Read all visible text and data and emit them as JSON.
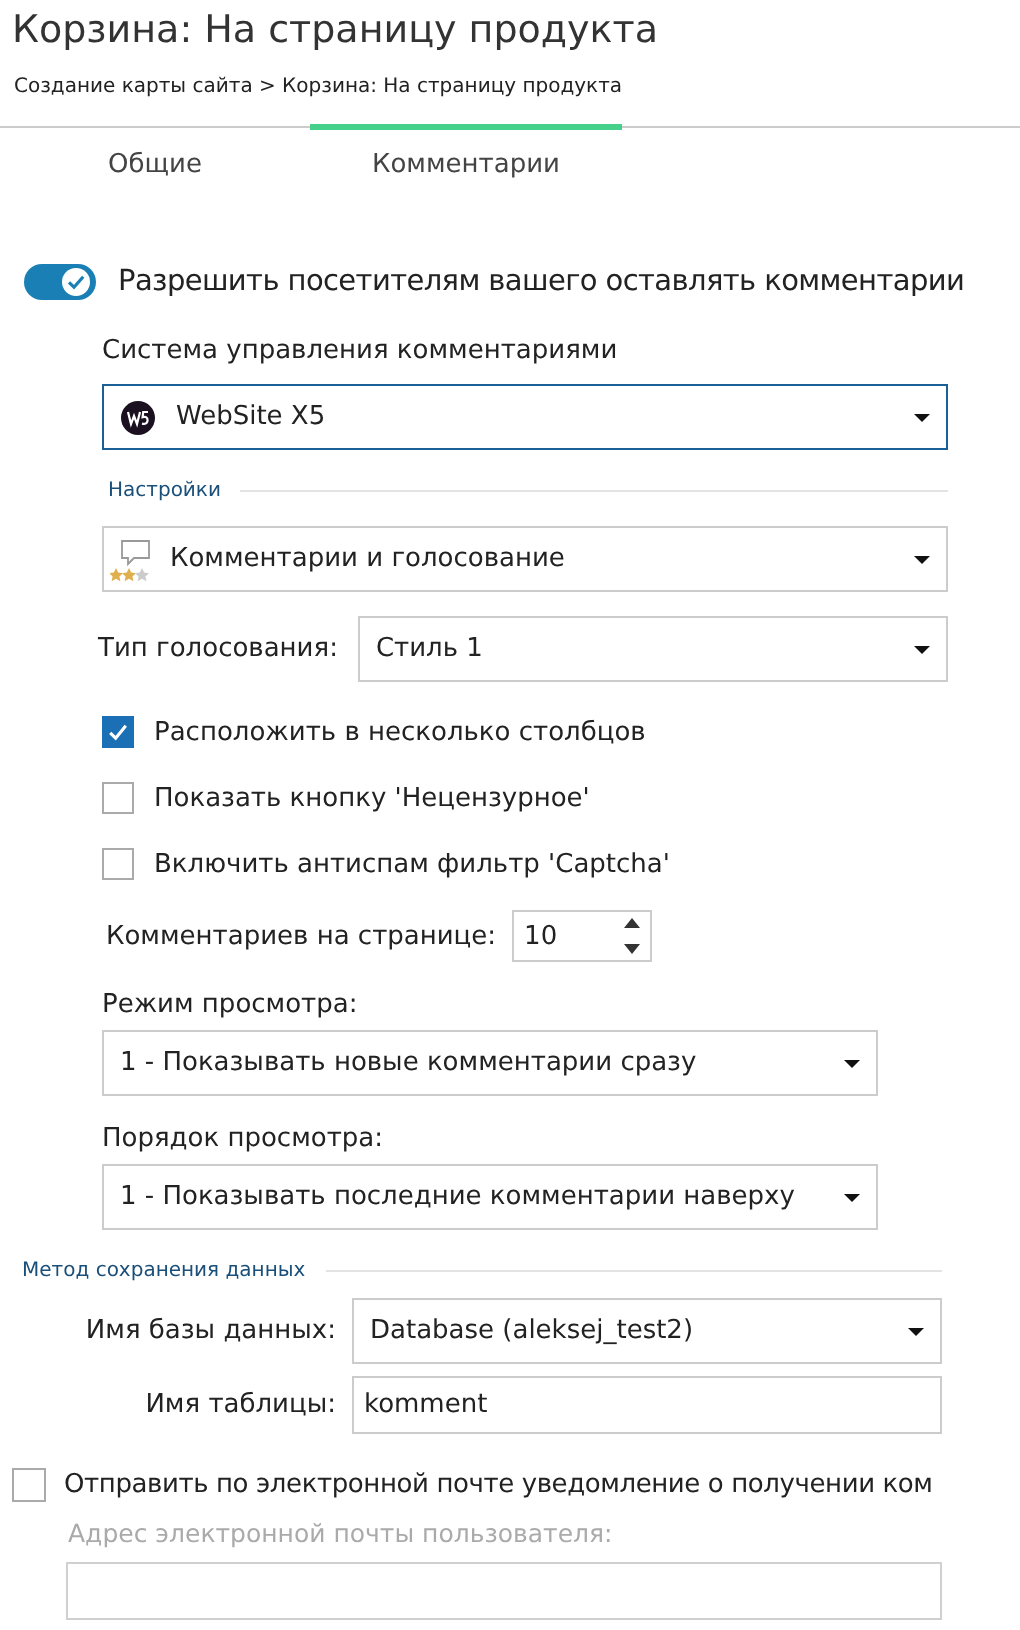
{
  "title": "Корзина: На страницу продукта",
  "breadcrumb": "Создание карты сайта > Корзина: На страницу продукта",
  "tabs": [
    {
      "label": "Общие",
      "selected": false
    },
    {
      "label": "Комментарии",
      "selected": true
    }
  ],
  "allow_comments": {
    "label": "Разрешить посетителям вашего оставлять комментарии",
    "on": true
  },
  "comment_system": {
    "label": "Система управления комментариями",
    "value": "WebSite X5"
  },
  "settings": {
    "heading": "Настройки",
    "mode": "Комментарии и голосование",
    "voting": {
      "label": "Тип голосования:",
      "value": "Стиль 1"
    },
    "options": [
      {
        "label": "Расположить в несколько столбцов",
        "checked": true
      },
      {
        "label": "Показать кнопку 'Нецензурное'",
        "checked": false
      },
      {
        "label": "Включить антиспам фильтр 'Captcha'",
        "checked": false
      }
    ],
    "per_page": {
      "label": "Комментариев на странице:",
      "value": "10"
    },
    "view_mode": {
      "label": "Режим просмотра:",
      "value": "1 - Показывать новые комментарии сразу"
    },
    "view_order": {
      "label": "Порядок просмотра:",
      "value": "1 - Показывать последние комментарии наверху"
    }
  },
  "storage": {
    "heading": "Метод сохранения данных",
    "database": {
      "label": "Имя базы данных:",
      "value": "Database (aleksej_test2)"
    },
    "table": {
      "label": "Имя таблицы:",
      "value": "komment"
    }
  },
  "email_notify": {
    "label": "Отправить по электронной почте уведомление о получении ком",
    "checked": false
  },
  "email_field": {
    "label": "Адрес электронной почты пользователя:",
    "disabled": true
  }
}
